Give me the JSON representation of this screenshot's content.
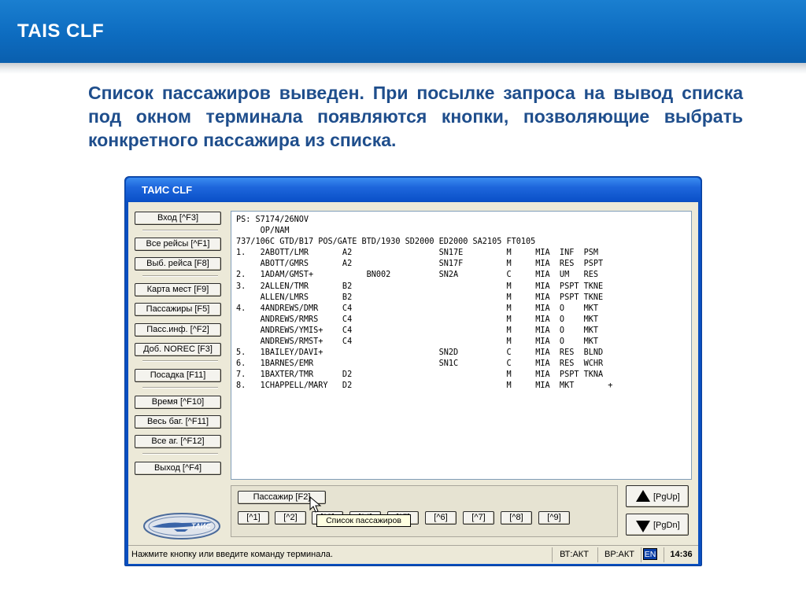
{
  "slide": {
    "title": "TAIS CLF",
    "caption": "Список пассажиров выведен. При посылке запроса на вывод списка под окном терминала появляются кнопки, позволяющие выбрать конкретного пассажира из списка."
  },
  "window": {
    "title": "ТАИС CLF"
  },
  "menu": [
    {
      "label": "Вход [^F3]"
    },
    {
      "label": "Все рейсы [^F1]"
    },
    {
      "label": "Выб. рейса [F8]"
    },
    {
      "label": "Карта мест [F9]"
    },
    {
      "label": "Пассажиры [F5]"
    },
    {
      "label": "Пасс.инф. [^F2]"
    },
    {
      "label": "Доб. NOREC [F3]"
    },
    {
      "label": "Посадка [F11]"
    },
    {
      "label": "Время [^F10]"
    },
    {
      "label": "Весь баг. [^F11]"
    },
    {
      "label": "Все аг. [^F12]"
    },
    {
      "label": "Выход [^F4]"
    }
  ],
  "terminal": {
    "lines": [
      "PS: S7174/26NOV",
      "     OP/NAM",
      "737/106C GTD/B17 POS/GATE BTD/1930 SD2000 ED2000 SA2105 FT0105",
      "1.   2ABOTT/LMR       A2                  SN17E         M     MIA  INF  PSM",
      "     ABOTT/GMRS       A2                  SN17F         M     MIA  RES  PSPT",
      "2.   1ADAM/GMST+           BN002          SN2A          C     MIA  UM   RES",
      "3.   2ALLEN/TMR       B2                                M     MIA  PSPT TKNE",
      "     ALLEN/LMRS       B2                                M     MIA  PSPT TKNE",
      "4.   4ANDREWS/DMR     C4                                M     MIA  O    MKT",
      "     ANDREWS/RMRS     C4                                M     MIA  O    MKT",
      "     ANDREWS/YMIS+    C4                                M     MIA  O    MKT",
      "     ANDREWS/RMST+    C4                                M     MIA  O    MKT",
      "5.   1BAILEY/DAVI+                        SN2D          C     MIA  RES  BLND",
      "6.   1BARNES/EMR                          SN1C          C     MIA  RES  WCHR",
      "7.   1BAXTER/TMR      D2                                M     MIA  PSPT TKNA",
      "8.   1CHAPPELL/MARY   D2                                M     MIA  MKT       +"
    ]
  },
  "pax_panel": {
    "main_button": "Пассажир [F2]",
    "number_buttons": [
      "[^1]",
      "[^2]",
      "[^3]",
      "[^4]",
      "[^5]",
      "[^6]",
      "[^7]",
      "[^8]",
      "[^9]"
    ],
    "tooltip": "Список пассажиров"
  },
  "paging": {
    "up_label": "[PgUp]",
    "down_label": "[PgDn]"
  },
  "statusbar": {
    "message": "Нажмите кнопку или введите команду терминала.",
    "cell1": "ВТ:АКТ",
    "cell2": "ВР:АКТ",
    "lang": "EN",
    "time": "14:36"
  },
  "colors": {
    "header_blue": "#0d6cc0",
    "caption_blue": "#1f4e8c",
    "window_blue": "#0a50c8",
    "client_bg": "#ece9d8"
  }
}
